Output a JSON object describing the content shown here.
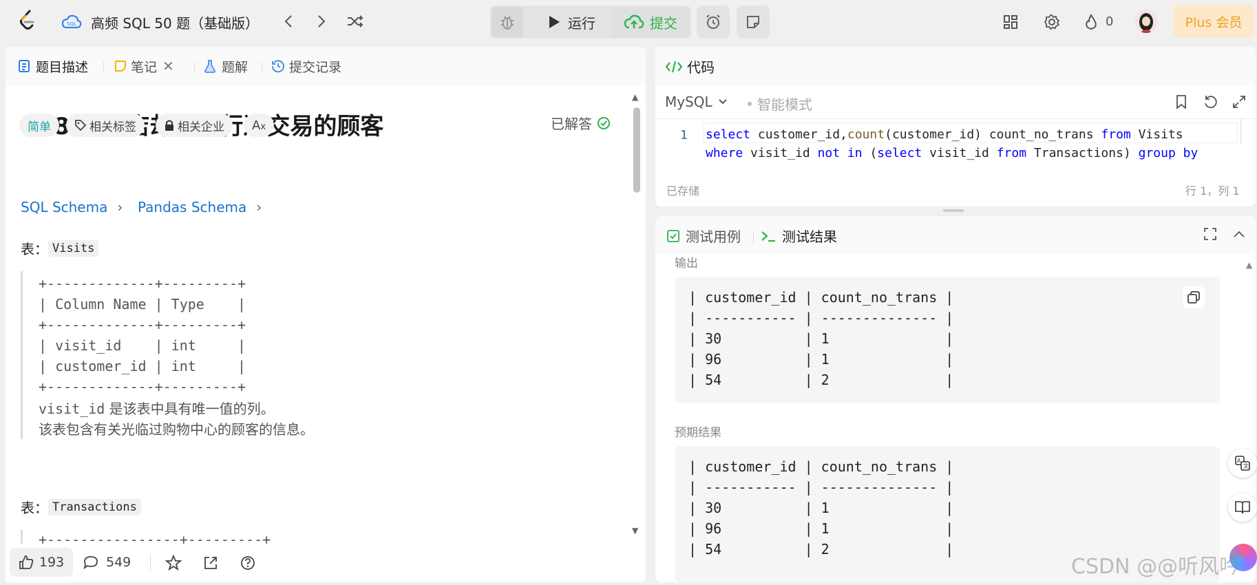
{
  "header": {
    "title": "高频 SQL 50 题（基础版）",
    "run_label": "运行",
    "submit_label": "提交",
    "flame_count": "0",
    "plus_label": "Plus 会员"
  },
  "left_tabs": {
    "description": "题目描述",
    "notes": "笔记",
    "solutions": "题解",
    "submissions": "提交记录"
  },
  "problem": {
    "title": "1581. 进店却未进行过交易的顾客",
    "status": "已解答",
    "difficulty": "简单",
    "tags_label": "相关标签",
    "companies_label": "相关企业",
    "sql_schema": "SQL Schema",
    "pandas_schema": "Pandas Schema",
    "table1_prefix": "表：",
    "table1_name": "Visits",
    "table1_lines": [
      "+-------------+---------+",
      "| Column Name | Type    |",
      "+-------------+---------+",
      "| visit_id    | int     |",
      "| customer_id | int     |",
      "+-------------+---------+"
    ],
    "table1_desc1_code": "visit_id",
    "table1_desc1_text": " 是该表中具有唯一值的列。",
    "table1_desc2": "该表包含有关光临过购物中心的顾客的信息。",
    "table2_prefix": "表：",
    "table2_name": "Transactions",
    "table2_partial": "+----------------+---------+"
  },
  "footer": {
    "likes": "193",
    "comments": "549"
  },
  "code_panel": {
    "title": "代码",
    "language": "MySQL",
    "mode": "智能模式",
    "saved": "已存储",
    "cursor": "行 1，列 1",
    "line_number": "1"
  },
  "results": {
    "testcase_tab": "测试用例",
    "result_tab": "测试结果",
    "output_label": "输出",
    "expected_label": "预期结果",
    "output_lines": [
      "| customer_id | count_no_trans |",
      "| ----------- | -------------- |",
      "| 30          | 1              |",
      "| 96          | 1              |",
      "| 54          | 2              |"
    ],
    "expected_lines": [
      "| customer_id | count_no_trans |",
      "| ----------- | -------------- |",
      "| 30          | 1              |",
      "| 96          | 1              |",
      "| 54          | 2              |"
    ]
  },
  "watermark": "CSDN @@听风吟"
}
